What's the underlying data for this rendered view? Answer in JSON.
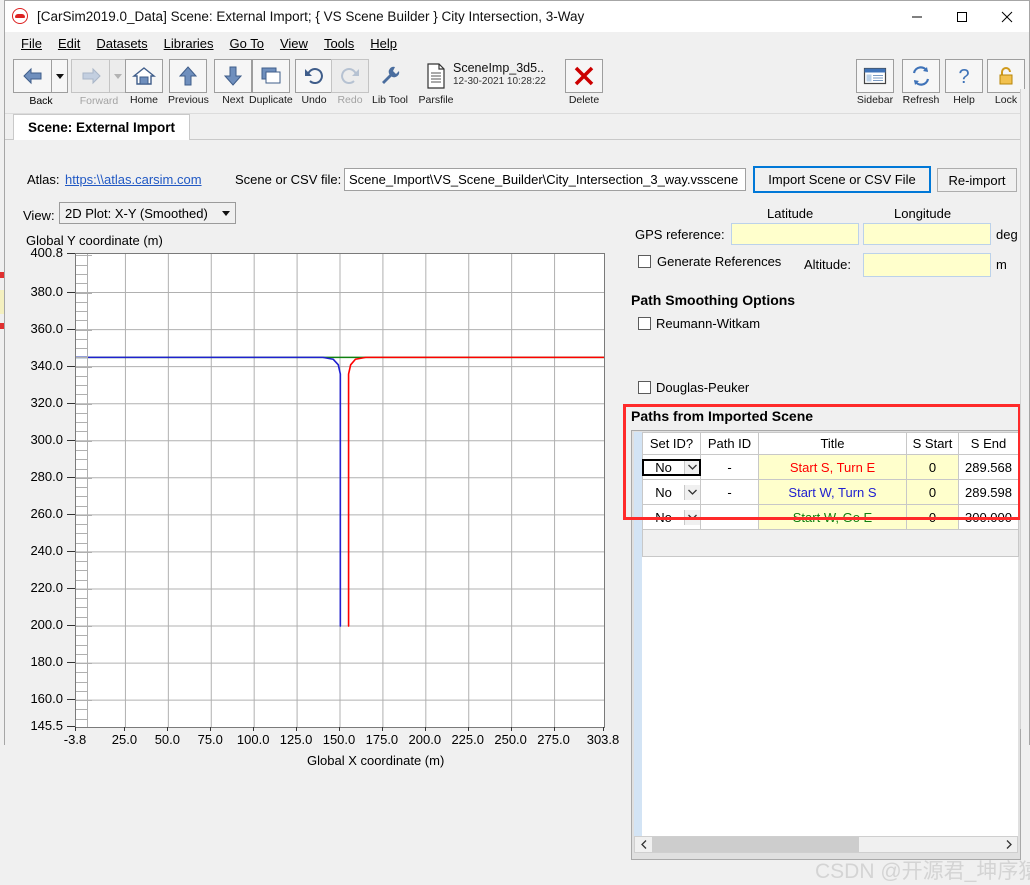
{
  "window": {
    "title": "[CarSim2019.0_Data] Scene: External Import; { VS Scene Builder } City Intersection, 3-Way",
    "app_icon": "carsim-icon",
    "minimize": "minimize-icon",
    "maximize": "maximize-icon",
    "close": "close-icon"
  },
  "menubar": {
    "items": [
      {
        "label": "File"
      },
      {
        "label": "Edit"
      },
      {
        "label": "Datasets"
      },
      {
        "label": "Libraries"
      },
      {
        "label": "Go To"
      },
      {
        "label": "View"
      },
      {
        "label": "Tools"
      },
      {
        "label": "Help"
      }
    ]
  },
  "toolbar": {
    "back": "Back",
    "forward": "Forward",
    "home": "Home",
    "previous": "Previous",
    "next": "Next",
    "duplicate": "Duplicate",
    "undo": "Undo",
    "redo": "Redo",
    "lib_tool": "Lib Tool",
    "parsfile": "Parsfile",
    "parsfile_name": "SceneImp_3d5..",
    "parsfile_date": "12-30-2021 10:28:22",
    "delete": "Delete",
    "sidebar": "Sidebar",
    "refresh": "Refresh",
    "help": "Help",
    "lock": "Lock"
  },
  "tab": {
    "label": "Scene: External Import"
  },
  "form": {
    "atlas_label": "Atlas:",
    "atlas_link": "https:\\\\atlas.carsim.com",
    "scene_file_label": "Scene or CSV file:",
    "scene_file_value": "Scene_Import\\VS_Scene_Builder\\City_Intersection_3_way.vsscene",
    "import_button": "Import Scene or CSV File",
    "reimport_button": "Re-import",
    "view_label": "View:",
    "view_value": "2D Plot: X-Y (Smoothed)",
    "view_options": [
      "2D Plot: X-Y (Smoothed)"
    ],
    "latitude_label": "Latitude",
    "longitude_label": "Longitude",
    "gps_reference_label": "GPS reference:",
    "gps_latitude_value": "",
    "gps_longitude_value": "",
    "deg_unit": "deg",
    "generate_references_label": "Generate References",
    "generate_references_checked": false,
    "altitude_label": "Altitude:",
    "altitude_value": "",
    "m_unit": "m",
    "path_smoothing_heading": "Path Smoothing Options",
    "reumann_witkam_label": "Reumann-Witkam",
    "reumann_witkam_checked": false,
    "douglas_peuker_label": "Douglas-Peuker",
    "douglas_peuker_checked": false
  },
  "paths_section": {
    "heading": "Paths from Imported Scene",
    "columns": [
      "Set ID?",
      "Path ID",
      "Title",
      "S Start",
      "S End"
    ],
    "rows": [
      {
        "set_id": "No",
        "path_id": "-",
        "title": "Start S, Turn E",
        "title_color": "#ff0000",
        "s_start": "0",
        "s_end": "289.568",
        "selected": true
      },
      {
        "set_id": "No",
        "path_id": "-",
        "title": "Start W, Turn S",
        "title_color": "#2020d0",
        "s_start": "0",
        "s_end": "289.598",
        "selected": false
      },
      {
        "set_id": "No",
        "path_id": "-",
        "title": "Start W, Go E",
        "title_color": "#108010",
        "s_start": "0",
        "s_end": "300.000",
        "selected": false
      }
    ],
    "scroll_left": "‹",
    "scroll_right": "›",
    "highlight_color": "#ff2a2a"
  },
  "watermark": "CSDN @开源君_坤序猿",
  "chart_data": {
    "type": "line",
    "title": "",
    "ylabel": "Global Y coordinate (m)",
    "xlabel": "Global X coordinate (m)",
    "xlim": [
      -3.8,
      303.8
    ],
    "ylim": [
      145.5,
      400.8
    ],
    "grid": true,
    "legend": "none",
    "xticks": [
      "-3.8",
      "25.0",
      "50.0",
      "75.0",
      "100.0",
      "125.0",
      "150.0",
      "175.0",
      "200.0",
      "225.0",
      "250.0",
      "275.0",
      "303.8"
    ],
    "xtick_values": [
      -3.8,
      25.0,
      50.0,
      75.0,
      100.0,
      125.0,
      150.0,
      175.0,
      200.0,
      225.0,
      250.0,
      275.0,
      303.8
    ],
    "yticks": [
      "400.8",
      "380.0",
      "360.0",
      "340.0",
      "320.0",
      "300.0",
      "280.0",
      "260.0",
      "240.0",
      "220.0",
      "200.0",
      "180.0",
      "160.0",
      "145.5"
    ],
    "ytick_values": [
      400.8,
      380.0,
      360.0,
      340.0,
      320.0,
      300.0,
      280.0,
      260.0,
      240.0,
      220.0,
      200.0,
      180.0,
      160.0,
      145.5
    ],
    "series": [
      {
        "name": "Start W, Go E",
        "color": "#108010",
        "points": [
          [
            -3.8,
            345.0
          ],
          [
            303.8,
            345.0
          ]
        ]
      },
      {
        "name": "Start W, Turn S",
        "color": "#2020d0",
        "points": [
          [
            -3.8,
            345.0
          ],
          [
            140.0,
            345.0
          ],
          [
            146.0,
            344.0
          ],
          [
            149.0,
            341.0
          ],
          [
            150.2,
            336.0
          ],
          [
            150.2,
            200.0
          ]
        ]
      },
      {
        "name": "Start S, Turn E",
        "color": "#ff0000",
        "points": [
          [
            155.0,
            200.0
          ],
          [
            155.0,
            336.0
          ],
          [
            156.2,
            341.0
          ],
          [
            159.0,
            344.0
          ],
          [
            165.0,
            345.0
          ],
          [
            303.8,
            345.0
          ]
        ]
      }
    ]
  }
}
